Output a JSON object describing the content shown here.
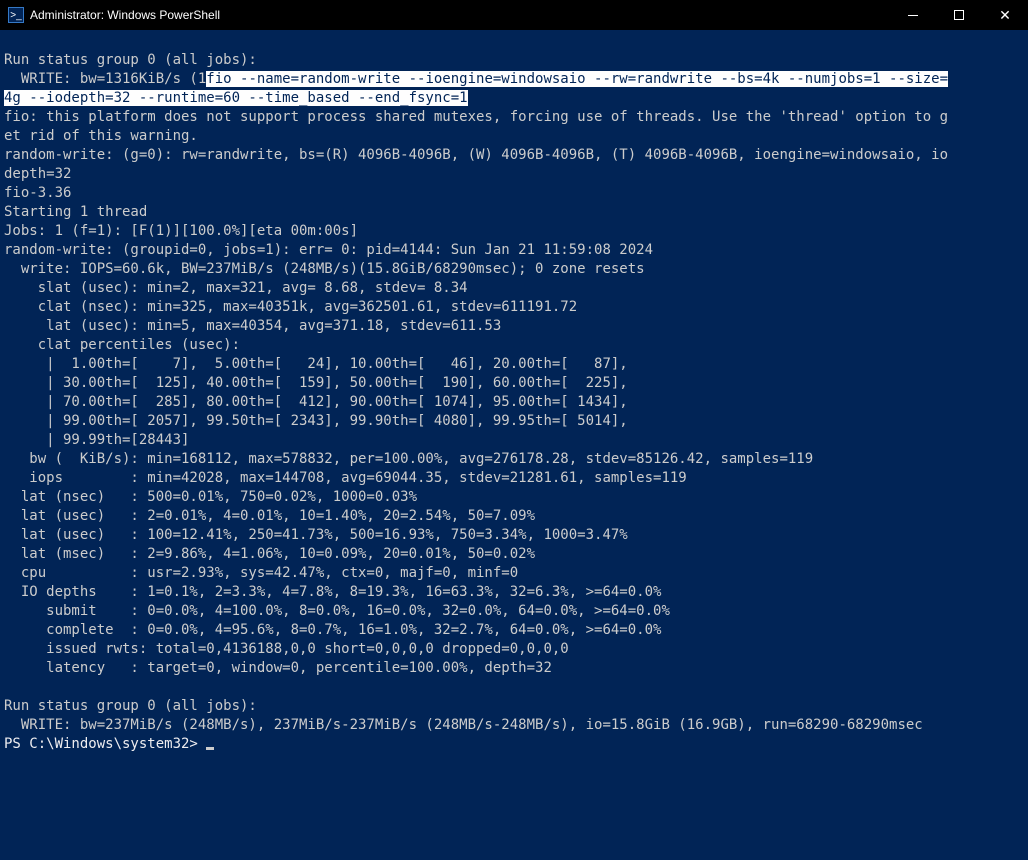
{
  "window": {
    "title": "Administrator: Windows PowerShell"
  },
  "terminal": {
    "blank0": "",
    "l0": "Run status group 0 (all jobs):",
    "l1a": "  WRITE: bw=1316KiB/s (1",
    "l1b": "fio --name=random-write --ioengine=windowsaio --rw=randwrite --bs=4k --numjobs=1 --size=",
    "l2": "4g --iodepth=32 --runtime=60 --time_based --end_fsync=1",
    "l3": "fio: this platform does not support process shared mutexes, forcing use of threads. Use the 'thread' option to g",
    "l4": "et rid of this warning.",
    "l5": "random-write: (g=0): rw=randwrite, bs=(R) 4096B-4096B, (W) 4096B-4096B, (T) 4096B-4096B, ioengine=windowsaio, io",
    "l6": "depth=32",
    "l7": "fio-3.36",
    "l8": "Starting 1 thread",
    "l9": "Jobs: 1 (f=1): [F(1)][100.0%][eta 00m:00s]",
    "l10": "random-write: (groupid=0, jobs=1): err= 0: pid=4144: Sun Jan 21 11:59:08 2024",
    "l11": "  write: IOPS=60.6k, BW=237MiB/s (248MB/s)(15.8GiB/68290msec); 0 zone resets",
    "l12": "    slat (usec): min=2, max=321, avg= 8.68, stdev= 8.34",
    "l13": "    clat (nsec): min=325, max=40351k, avg=362501.61, stdev=611191.72",
    "l14": "     lat (usec): min=5, max=40354, avg=371.18, stdev=611.53",
    "l15": "    clat percentiles (usec):",
    "l16": "     |  1.00th=[    7],  5.00th=[   24], 10.00th=[   46], 20.00th=[   87],",
    "l17": "     | 30.00th=[  125], 40.00th=[  159], 50.00th=[  190], 60.00th=[  225],",
    "l18": "     | 70.00th=[  285], 80.00th=[  412], 90.00th=[ 1074], 95.00th=[ 1434],",
    "l19": "     | 99.00th=[ 2057], 99.50th=[ 2343], 99.90th=[ 4080], 99.95th=[ 5014],",
    "l20": "     | 99.99th=[28443]",
    "l21": "   bw (  KiB/s): min=168112, max=578832, per=100.00%, avg=276178.28, stdev=85126.42, samples=119",
    "l22": "   iops        : min=42028, max=144708, avg=69044.35, stdev=21281.61, samples=119",
    "l23": "  lat (nsec)   : 500=0.01%, 750=0.02%, 1000=0.03%",
    "l24": "  lat (usec)   : 2=0.01%, 4=0.01%, 10=1.40%, 20=2.54%, 50=7.09%",
    "l25": "  lat (usec)   : 100=12.41%, 250=41.73%, 500=16.93%, 750=3.34%, 1000=3.47%",
    "l26": "  lat (msec)   : 2=9.86%, 4=1.06%, 10=0.09%, 20=0.01%, 50=0.02%",
    "l27": "  cpu          : usr=2.93%, sys=42.47%, ctx=0, majf=0, minf=0",
    "l28": "  IO depths    : 1=0.1%, 2=3.3%, 4=7.8%, 8=19.3%, 16=63.3%, 32=6.3%, >=64=0.0%",
    "l29": "     submit    : 0=0.0%, 4=100.0%, 8=0.0%, 16=0.0%, 32=0.0%, 64=0.0%, >=64=0.0%",
    "l30": "     complete  : 0=0.0%, 4=95.6%, 8=0.7%, 16=1.0%, 32=2.7%, 64=0.0%, >=64=0.0%",
    "l31": "     issued rwts: total=0,4136188,0,0 short=0,0,0,0 dropped=0,0,0,0",
    "l32": "     latency   : target=0, window=0, percentile=100.00%, depth=32",
    "blank1": "",
    "l33": "Run status group 0 (all jobs):",
    "l34": "  WRITE: bw=237MiB/s (248MB/s), 237MiB/s-237MiB/s (248MB/s-248MB/s), io=15.8GiB (16.9GB), run=68290-68290msec",
    "prompt": "PS C:\\Windows\\system32> "
  }
}
